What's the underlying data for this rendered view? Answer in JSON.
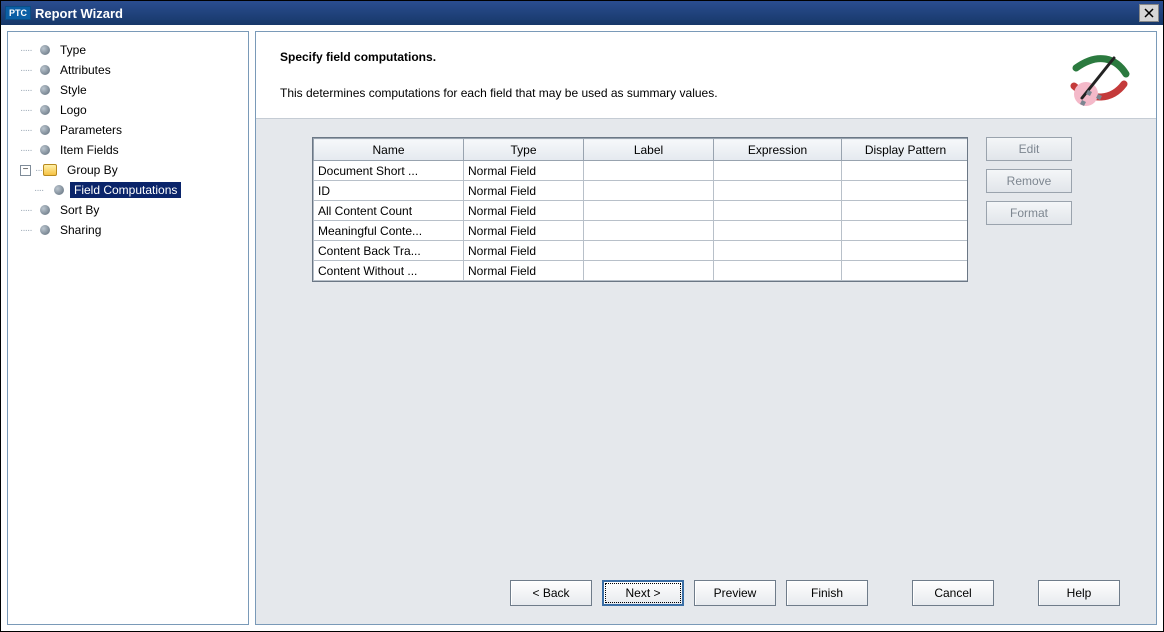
{
  "window": {
    "brand": "PTC",
    "title": "Report Wizard"
  },
  "tree": {
    "items": [
      {
        "label": "Type",
        "kind": "leaf"
      },
      {
        "label": "Attributes",
        "kind": "leaf"
      },
      {
        "label": "Style",
        "kind": "leaf"
      },
      {
        "label": "Logo",
        "kind": "leaf"
      },
      {
        "label": "Parameters",
        "kind": "leaf"
      },
      {
        "label": "Item Fields",
        "kind": "leaf"
      },
      {
        "label": "Group By",
        "kind": "folder",
        "expanded": true,
        "children": [
          {
            "label": "Field Computations",
            "kind": "leaf",
            "selected": true
          }
        ]
      },
      {
        "label": "Sort By",
        "kind": "leaf"
      },
      {
        "label": "Sharing",
        "kind": "leaf"
      }
    ]
  },
  "header": {
    "heading": "Specify field computations.",
    "subtext": "This determines computations for each field that may be used as summary values."
  },
  "table": {
    "columns": [
      "Name",
      "Type",
      "Label",
      "Expression",
      "Display Pattern"
    ],
    "rows": [
      {
        "name": "Document Short ...",
        "type": "Normal Field",
        "label": "",
        "expression": "",
        "pattern": ""
      },
      {
        "name": "ID",
        "type": "Normal Field",
        "label": "",
        "expression": "",
        "pattern": ""
      },
      {
        "name": "All Content Count",
        "type": "Normal Field",
        "label": "",
        "expression": "",
        "pattern": ""
      },
      {
        "name": "Meaningful Conte...",
        "type": "Normal Field",
        "label": "",
        "expression": "",
        "pattern": ""
      },
      {
        "name": "Content Back Tra...",
        "type": "Normal Field",
        "label": "",
        "expression": "",
        "pattern": ""
      },
      {
        "name": "Content Without ...",
        "type": "Normal Field",
        "label": "",
        "expression": "",
        "pattern": ""
      }
    ]
  },
  "side_buttons": {
    "edit": "Edit",
    "remove": "Remove",
    "format": "Format"
  },
  "buttons": {
    "back": "< Back",
    "next": "Next >",
    "preview": "Preview",
    "finish": "Finish",
    "cancel": "Cancel",
    "help": "Help"
  }
}
